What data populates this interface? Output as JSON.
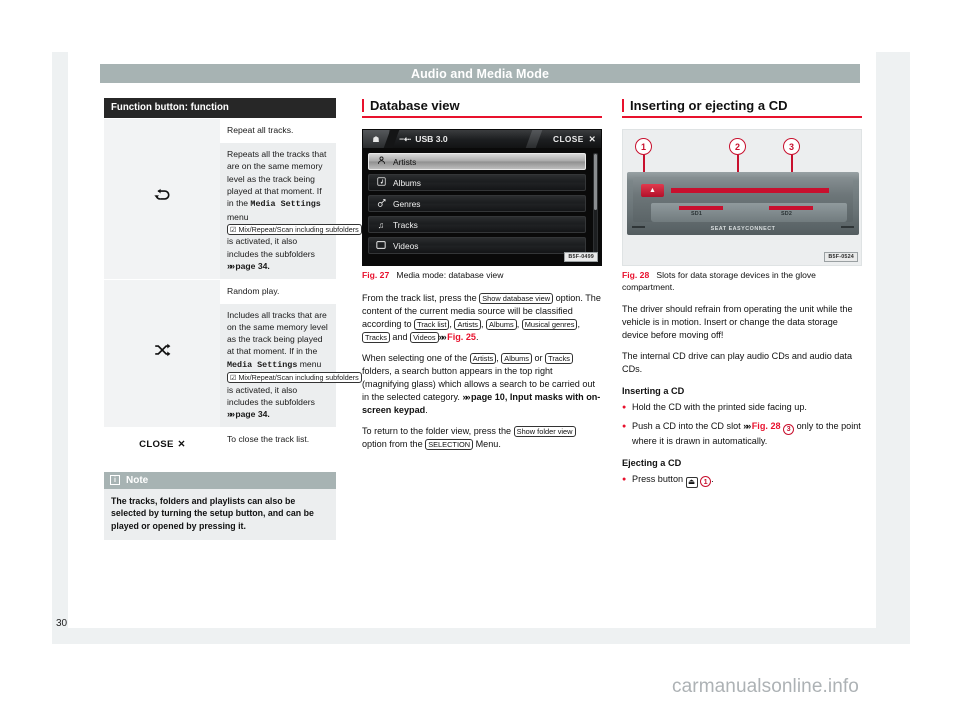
{
  "running_header": "Audio and Media Mode",
  "folio": "30",
  "watermark": "carmanualsonline.info",
  "column_left": {
    "table": {
      "header": "Function button: function",
      "rows": [
        {
          "icon": "repeat-icon",
          "icon_glyph": "↻",
          "summary": "Repeat all tracks.",
          "detail_1": "Repeats all the tracks that are on the same memory level as the track being played at that moment. If in the ",
          "detail_mono": "Media Settings",
          "detail_2": " menu ",
          "detail_btn": "☑ Mix/Repeat/Scan including subfolders",
          "detail_3": " is activated, it also includes the subfolders ",
          "detail_ref": "page 34."
        },
        {
          "icon": "shuffle-icon",
          "icon_glyph": "⤨",
          "summary": "Random play.",
          "detail_1": "Includes all tracks that are on the same memory level as the track being played at that moment. If in the ",
          "detail_mono": "Media Settings",
          "detail_2": " menu ",
          "detail_btn": "☑ Mix/Repeat/Scan including subfolders",
          "detail_3": " is activated, it also includes the subfolders ",
          "detail_ref": "page 34."
        }
      ],
      "close_row": {
        "label": "CLOSE",
        "close_glyph": "✕",
        "text": "To close the track list."
      }
    },
    "note": {
      "icon": "info-icon",
      "icon_glyph": "i",
      "title": "Note",
      "body": "The tracks, folders and playlists can also be selected by turning the setup button, and can be played or opened by pressing it."
    }
  },
  "column_middle": {
    "heading": "Database view",
    "screen": {
      "home_icon": "home-icon",
      "usb_icon": "usb-icon",
      "source_label": "USB 3.0",
      "close_label": "CLOSE",
      "close_glyph": "✕",
      "items": [
        {
          "label": "Artists",
          "icon": "person-icon",
          "glyph": "\u0001",
          "selected": true
        },
        {
          "label": "Albums",
          "icon": "album-icon",
          "glyph": "▣",
          "selected": false
        },
        {
          "label": "Genres",
          "icon": "genre-icon",
          "glyph": "⚥",
          "selected": false
        },
        {
          "label": "Tracks",
          "icon": "note-icon",
          "glyph": "♫",
          "selected": false
        },
        {
          "label": "Videos",
          "icon": "video-icon",
          "glyph": "□",
          "selected": false
        }
      ],
      "image_code": "B5F-0499"
    },
    "figure_caption": {
      "number": "Fig. 27",
      "text": "Media mode: database view"
    },
    "para_1": {
      "t1": "From the track list, press the ",
      "b1": "Show database view",
      "t2": " option. The content of the current media source will be classified according to ",
      "b2": "Track list",
      "t3": ", ",
      "b3": "Artists",
      "t4": ", ",
      "b4": "Albums",
      "t5": ", ",
      "b5": "Musical genres",
      "t6": ", ",
      "b6": "Tracks",
      "t7": " and ",
      "b7": "Videos",
      "t8": " ",
      "ref": "Fig. 25",
      "t9": "."
    },
    "para_2": {
      "t1": "When selecting one of the ",
      "b1": "Artists",
      "t2": ", ",
      "b2": "Albums",
      "t3": " or ",
      "b3": "Tracks",
      "t4": " folders, a search button appears in the top right (magnifying glass) which allows a search to be carried out in the selected category. ",
      "ref": "page 10, Input masks with on-screen keypad",
      "t5": "."
    },
    "para_3": {
      "t1": "To return to the folder view, press the ",
      "b1": "Show folder view",
      "t2": " option from the ",
      "b2": "SELECTION",
      "t3": " Menu."
    }
  },
  "column_right": {
    "heading": "Inserting or ejecting a CD",
    "figure": {
      "callouts": [
        "1",
        "2",
        "3"
      ],
      "eject_icon": "eject-icon",
      "slot_labels": [
        "SD1",
        "SD2"
      ],
      "brand": "SEAT EASYCONNECT",
      "image_code": "B5F-0524"
    },
    "figure_caption": {
      "number": "Fig. 28",
      "text": "Slots for data storage devices in the glove compartment."
    },
    "para_1": "The driver should refrain from operating the unit while the vehicle is in motion. Insert or change the data storage device before moving off!",
    "para_2": "The internal CD drive can play audio CDs and audio data CDs.",
    "sub_1": "Inserting a CD",
    "bullets_1": [
      {
        "t1": "Hold the CD with the printed side facing up.",
        "ref": "",
        "num": "",
        "t2": ""
      },
      {
        "t1": "Push a CD into the CD slot ",
        "ref": "Fig. 28",
        "num": "3",
        "t2": " only to the point where it is drawn in automatically."
      }
    ],
    "sub_2": "Ejecting a CD",
    "bullets_2": [
      {
        "t1": "Press button ",
        "key": "⏏",
        "num": "1",
        "t2": "."
      }
    ]
  },
  "colors": {
    "accent_red": "#e8112d",
    "header_band": "#a7b3b3",
    "table_header": "#272727",
    "page_bg": "#eef1f2"
  }
}
